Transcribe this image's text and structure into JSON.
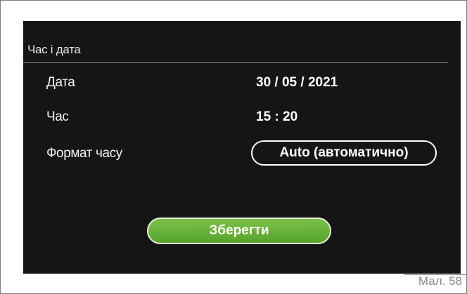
{
  "screen": {
    "title": "Час і дата"
  },
  "rows": [
    {
      "label": "Дата",
      "value": "30 / 05 / 2021"
    },
    {
      "label": "Час",
      "value": "15 : 20"
    },
    {
      "label": "Формат часу",
      "value": "Auto (автоматично)"
    }
  ],
  "actions": {
    "save_label": "Зберегти"
  },
  "figure": {
    "caption": "Мал. 58"
  },
  "colors": {
    "screen_background": "#151515",
    "save_button": "#66b037",
    "text": "#ffffff"
  }
}
